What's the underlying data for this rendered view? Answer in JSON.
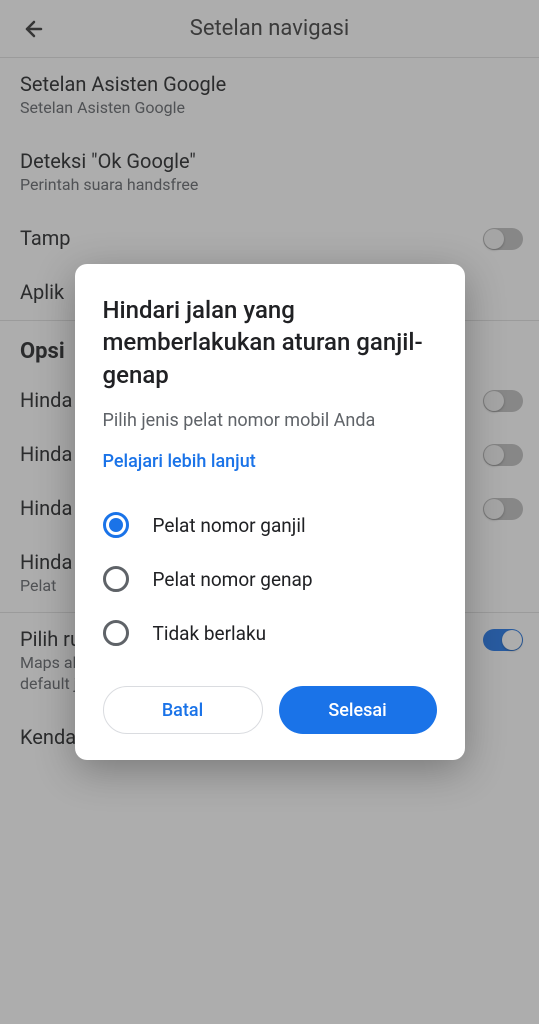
{
  "appbar": {
    "title": "Setelan navigasi"
  },
  "settings": {
    "items": [
      {
        "title": "Setelan Asisten Google",
        "sub": "Setelan Asisten Google"
      },
      {
        "title": "Deteksi \"Ok Google\"",
        "sub": "Perintah suara handsfree"
      },
      {
        "title": "Tamp"
      },
      {
        "title": "Aplik"
      }
    ],
    "optionsHeader": "Opsi",
    "optionItems": [
      {
        "title": "Hinda"
      },
      {
        "title": "Hinda"
      },
      {
        "title": "Hinda"
      },
      {
        "title": "Hinda",
        "sub": "Pelat"
      },
      {
        "title": "Pilih ruteyang hemat bahan bakar",
        "sub": "Maps akan menyarankan rute hemat bahan bakar secara default jika waktu tibanya serupa",
        "on": true
      },
      {
        "title": "Kendaraan Anda"
      }
    ]
  },
  "dialog": {
    "title": "Hindari jalan yang memberlakukan aturan ganjil-genap",
    "sub": "Pilih jenis pelat nomor mobil Anda",
    "link": "Pelajari lebih lanjut",
    "options": [
      {
        "label": "Pelat nomor ganjil",
        "selected": true
      },
      {
        "label": "Pelat nomor genap",
        "selected": false
      },
      {
        "label": "Tidak berlaku",
        "selected": false
      }
    ],
    "cancel": "Batal",
    "confirm": "Selesai"
  },
  "colors": {
    "accent": "#1a73e8"
  }
}
